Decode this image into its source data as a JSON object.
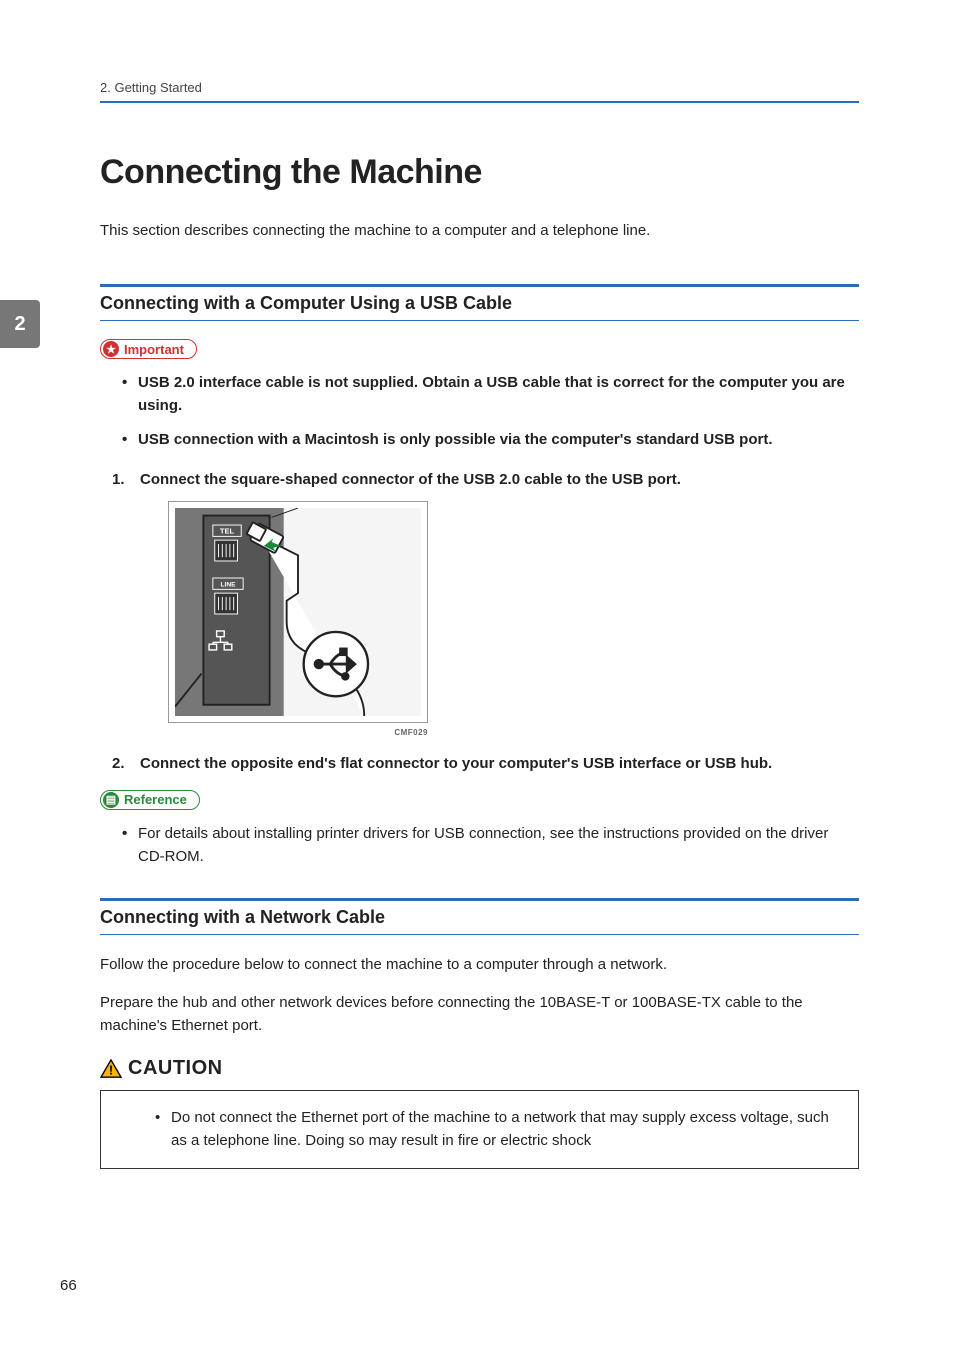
{
  "header": {
    "breadcrumb": "2. Getting Started"
  },
  "side_tab": "2",
  "title": "Connecting the Machine",
  "intro": "This section describes connecting the machine to a computer and a telephone line.",
  "section_usb": {
    "heading": "Connecting with a Computer Using a USB Cable",
    "important_label": "Important",
    "important_items": [
      "USB 2.0 interface cable is not supplied. Obtain a USB cable that is correct for the computer you are using.",
      "USB connection with a Macintosh is only possible via the computer's standard USB port."
    ],
    "steps": [
      "Connect the square-shaped connector of the USB 2.0 cable to the USB port.",
      "Connect the opposite end's flat connector to your computer's USB interface or USB hub."
    ],
    "figure_code": "CMF029",
    "reference_label": "Reference",
    "reference_items": [
      "For details about installing printer drivers for USB connection, see the instructions provided on the driver CD-ROM."
    ]
  },
  "section_network": {
    "heading": "Connecting with a Network Cable",
    "para1": "Follow the procedure below to connect the machine to a computer through a network.",
    "para2": "Prepare the hub and other network devices before connecting the 10BASE-T or 100BASE-TX cable to the machine's Ethernet port.",
    "caution_label": "CAUTION",
    "caution_items": [
      "Do not connect the Ethernet port of the machine to a network that may supply excess voltage, such as a telephone line. Doing so may result in fire or electric shock"
    ]
  },
  "page_number": "66"
}
